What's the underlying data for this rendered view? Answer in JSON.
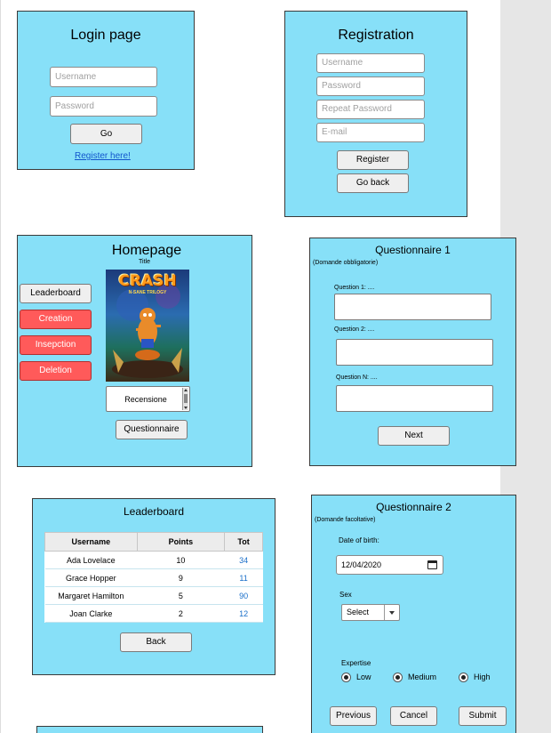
{
  "login": {
    "title": "Login page",
    "username_placeholder": "Username",
    "password_placeholder": "Password",
    "go_label": "Go",
    "register_link": "Register here!"
  },
  "registration": {
    "title": "Registration",
    "username_placeholder": "Username",
    "password_placeholder": "Password",
    "repeat_password_placeholder": "Repeat Password",
    "email_placeholder": "E-mail",
    "register_label": "Register",
    "go_back_label": "Go back"
  },
  "homepage": {
    "title": "Homepage",
    "subtitle": "Title",
    "sidebar": [
      "Leaderboard",
      "Creation",
      "Insepction",
      "Deletion"
    ],
    "cover_logo_text": "CRASH",
    "cover_sub_text": "N-SANE TRILOGY",
    "review_label": "Recensione",
    "questionnaire_button": "Questionnaire"
  },
  "questionnaire1": {
    "title": "Questionnaire 1",
    "note": "(Domande obbligatorie)",
    "q1": "Question 1: ....",
    "q2": "Question 2: ....",
    "qn": "Question N: ....",
    "next_label": "Next"
  },
  "leaderboard": {
    "title": "Leaderboard",
    "columns": [
      "Username",
      "Points",
      "Tot"
    ],
    "rows": [
      [
        "Ada Lovelace",
        "10",
        "34"
      ],
      [
        "Grace Hopper",
        "9",
        "11"
      ],
      [
        "Margaret Hamilton",
        "5",
        "90"
      ],
      [
        "Joan Clarke",
        "2",
        "12"
      ]
    ],
    "back_label": "Back"
  },
  "questionnaire2": {
    "title": "Questionnaire 2",
    "note": "(Domande facoltative)",
    "dob_label": "Date of birth:",
    "dob_value": "12/04/2020",
    "sex_label": "Sex",
    "sex_selected": "Select",
    "expertise_label": "Expertise",
    "options": [
      "Low",
      "Medium",
      "High"
    ],
    "previous_label": "Previous",
    "cancel_label": "Cancel",
    "submit_label": "Submit"
  },
  "colors": {
    "panel": "#87e0f8",
    "danger_button": "#ff5a5a",
    "link": "#1155cc"
  }
}
